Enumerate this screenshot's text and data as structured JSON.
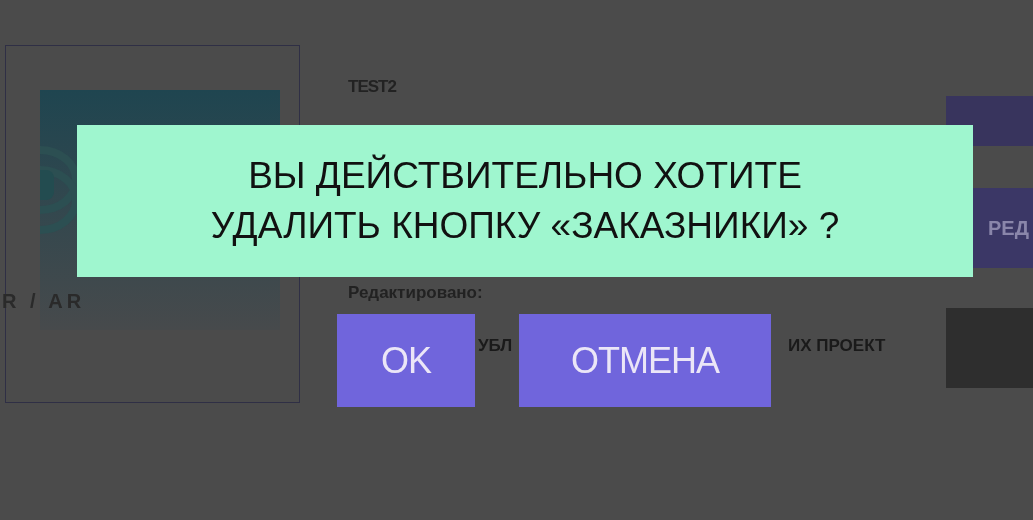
{
  "project_card": {
    "logo_caption": "R / AR"
  },
  "project_info": {
    "title": "TEST2",
    "edited_label": "Редактировано:",
    "publish_fragments": [
      "УБЛ",
      "ИХ ПРОЕКТ"
    ]
  },
  "side_buttons": [
    {
      "kind": "plain"
    },
    {
      "kind": "edit",
      "label": "РЕД"
    },
    {
      "kind": "dark"
    }
  ],
  "dialog": {
    "message_lines": [
      "ВЫ ДЕЙСТВИТЕЛЬНО ХОТИТЕ",
      "УДАЛИТЬ КНОПКУ «ЗАКАЗНИКИ» ?"
    ],
    "buttons": [
      "OK",
      "ОТМЕНА"
    ]
  }
}
